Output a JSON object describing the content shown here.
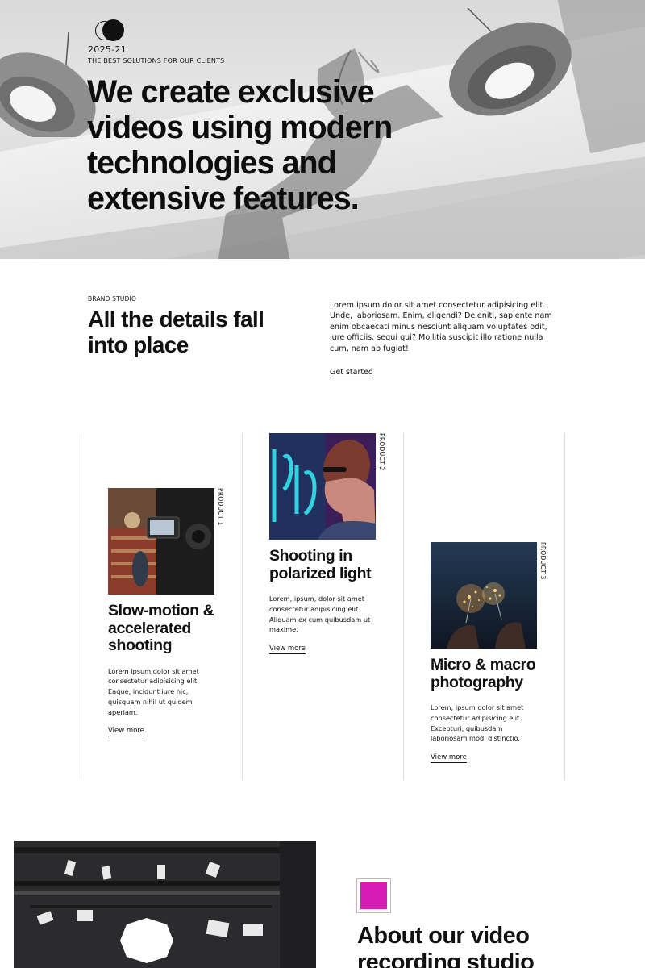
{
  "hero": {
    "year": "2025-21",
    "tagline": "THE BEST SOLUTIONS FOR OUR CLIENTS",
    "title": "We create exclusive videos using modern technologies and extensive features."
  },
  "intro": {
    "eyebrow": "BRAND STUDIO",
    "title": "All the details fall into place",
    "text": "Lorem ipsum dolor sit amet consectetur adipisicing elit. Unde, laboriosam. Enim, eligendi? Deleniti, sapiente nam enim obcaecati minus nesciunt aliquam voluptates odit, iure officiis, sequi qui? Mollitia suscipit illo ratione nulla cum, nam ab fugiat!",
    "cta": "Get started"
  },
  "products": [
    {
      "label": "PRODUCT 1",
      "image": "camera-in-library-photo",
      "title": "Slow-motion & accelerated shooting",
      "text": "Lorem ipsum dolor sit amet consectetur adipisicing elit. Eaque, incidunt iure hic, quisquam nihil ut quidem aperiam.",
      "link": "View more"
    },
    {
      "label": "PRODUCT 2",
      "image": "neon-portrait-photo",
      "title": "Shooting in polarized light",
      "text": "Lorem, ipsum, dolor sit amet consectetur adipisicing elit. Aliquam ex cum quibusdam ut maxime.",
      "link": "View more"
    },
    {
      "label": "PRODUCT 3",
      "image": "sparklers-photo",
      "title": "Micro & macro photography",
      "text": "Lorem, ipsum dolor sit amet consectetur adipisicing elit. Excepturi, quibusdam laboriosam modi distinctio.",
      "link": "View more"
    }
  ],
  "about": {
    "title": "About our video recording studio",
    "image": "studio-lighting-rig-photo",
    "accent_color": "#d81bb5"
  },
  "colors": {
    "text": "#111111",
    "divider": "#dcdcdc",
    "accent": "#d81bb5"
  },
  "icons": {
    "logo": "eclipse-logo-icon"
  }
}
